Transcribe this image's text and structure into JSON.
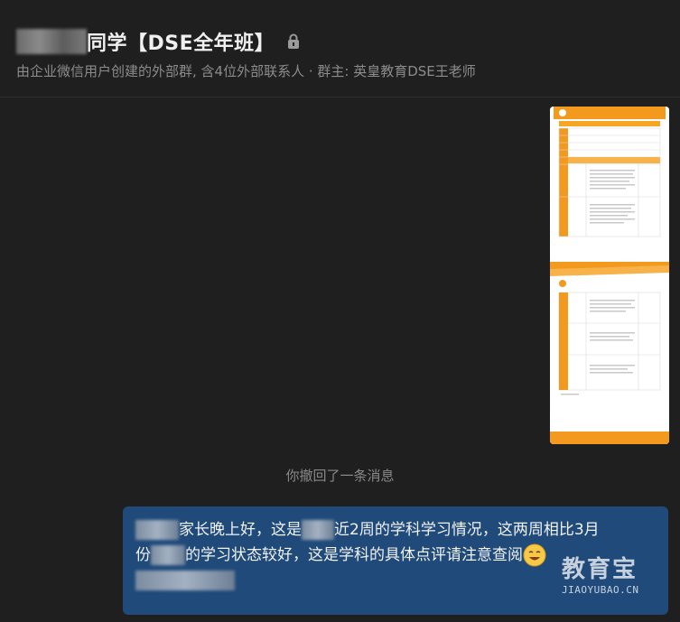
{
  "header": {
    "title": "同学【DSE全年班】",
    "subtitle": "由企业微信用户创建的外部群, 含4位外部联系人 · 群主: 英皇教育DSE王老师"
  },
  "system": {
    "recall_notice": "你撤回了一条消息"
  },
  "message": {
    "line1_a": "家长晚上好，这是",
    "line1_b": "近2周的学科学习情况，这两周相比3月",
    "line2_a": "份",
    "line2_b": "的学习状态较好，这是学科的具体点评请注意查阅"
  },
  "watermark": {
    "brand": "教育宝",
    "url": "JIAOYUBAO.CN"
  },
  "colors": {
    "background": "#1f1f1f",
    "bubble": "#1f4a7a",
    "doc_accent": "#f39a1e"
  },
  "icons": [
    "lock-icon",
    "smile-emoji-icon"
  ]
}
